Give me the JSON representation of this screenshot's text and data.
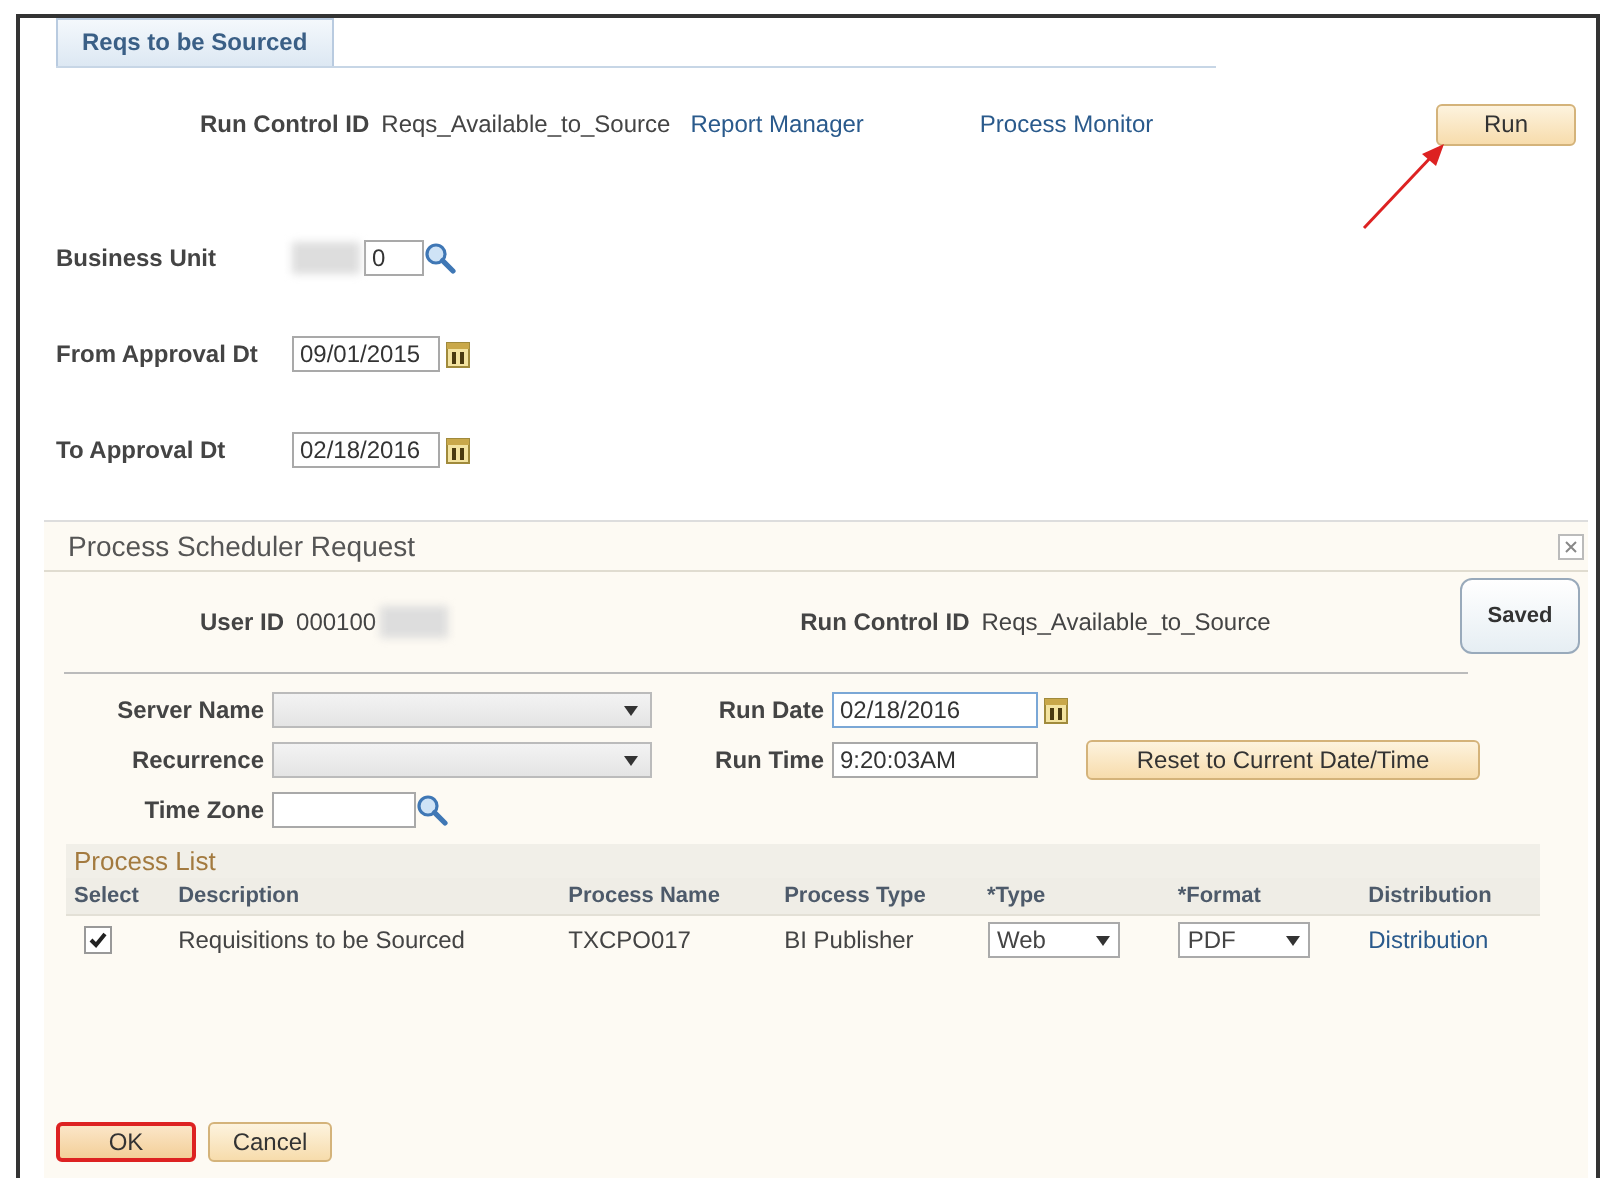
{
  "tab": {
    "label": "Reqs to be Sourced",
    "selected": true
  },
  "run_control": {
    "label": "Run Control ID",
    "value": "Reqs_Available_to_Source"
  },
  "links": [
    "Report Manager",
    "Process Monitor"
  ],
  "run_button": "Run",
  "fields": [
    {
      "label": "Business Unit",
      "value": "0",
      "kind": "lookup"
    },
    {
      "label": "From Approval Dt",
      "value": "09/01/2015",
      "kind": "date"
    },
    {
      "label": "To Approval Dt",
      "value": "02/18/2016",
      "kind": "date"
    }
  ],
  "dialog": {
    "title": "Process Scheduler Request",
    "saved_button": "Saved",
    "user_id": {
      "label": "User ID",
      "value": "000100"
    },
    "run_control": {
      "label": "Run Control ID",
      "value": "Reqs_Available_to_Source"
    },
    "server_name": {
      "label": "Server Name"
    },
    "recurrence": {
      "label": "Recurrence"
    },
    "time_zone": {
      "label": "Time Zone"
    },
    "run_date": {
      "label": "Run Date",
      "value": "02/18/2016"
    },
    "run_time": {
      "label": "Run Time",
      "value": "9:20:03AM"
    },
    "reset_button": "Reset to Current Date/Time",
    "process_list": {
      "title": "Process List",
      "columns": [
        "Select",
        "Description",
        "Process Name",
        "Process Type",
        "*Type",
        "*Format",
        "Distribution"
      ],
      "rows": [
        {
          "checked": true,
          "description": "Requisitions to be Sourced",
          "process_name": "TXCPO017",
          "process_type": "BI Publisher",
          "type": "Web",
          "format": "PDF",
          "distribution": "Distribution"
        }
      ]
    },
    "buttons": [
      {
        "label": "OK",
        "highlighted": true
      },
      {
        "label": "Cancel",
        "highlighted": false
      }
    ]
  }
}
